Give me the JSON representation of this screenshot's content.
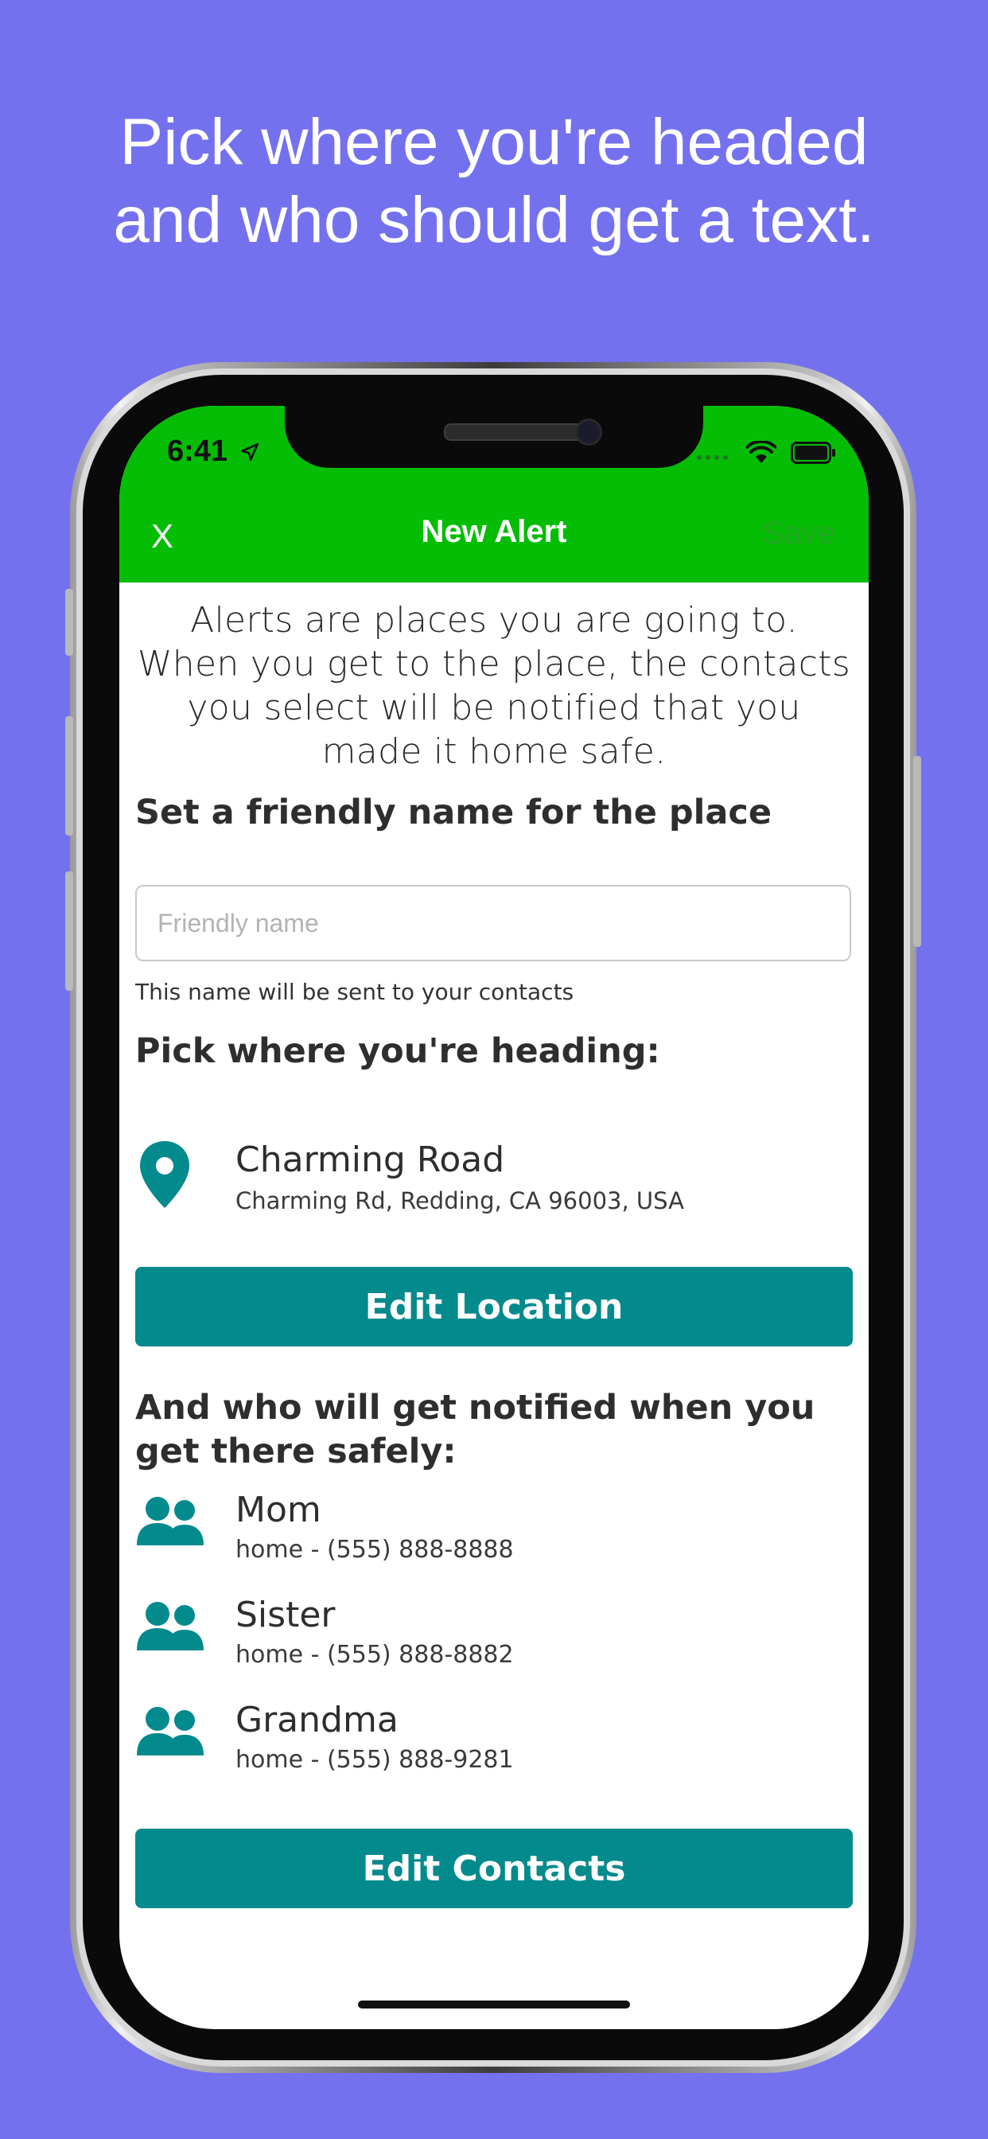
{
  "headline": {
    "line1": "Pick where you're headed",
    "line2": "and who should get a text."
  },
  "status_bar": {
    "time": "6:41",
    "icons": [
      "location-arrow-icon",
      "signal-icon",
      "wifi-icon",
      "battery-icon"
    ]
  },
  "nav": {
    "close_label": "X",
    "title": "New Alert",
    "save_label": "Save"
  },
  "intro": "Alerts are places you are going to. When you get to the place, the contacts you select will be notified that you made it home safe.",
  "friendly_name": {
    "title": "Set a friendly name for the place",
    "placeholder": "Friendly name",
    "value": "",
    "helper": "This name will be sent to your contacts"
  },
  "location": {
    "title": "Pick where you're heading:",
    "name": "Charming Road",
    "address": "Charming Rd, Redding, CA 96003, USA",
    "edit_label": "Edit Location"
  },
  "contacts": {
    "title": "And who will get notified when you get there safely:",
    "items": [
      {
        "name": "Mom",
        "phone": "home - (555) 888-8888"
      },
      {
        "name": "Sister",
        "phone": "home - (555) 888-8882"
      },
      {
        "name": "Grandma",
        "phone": "home - (555) 888-9281"
      }
    ],
    "edit_label": "Edit Contacts"
  },
  "colors": {
    "background": "#7471ef",
    "header": "#05bd05",
    "accent": "#038a8d"
  }
}
